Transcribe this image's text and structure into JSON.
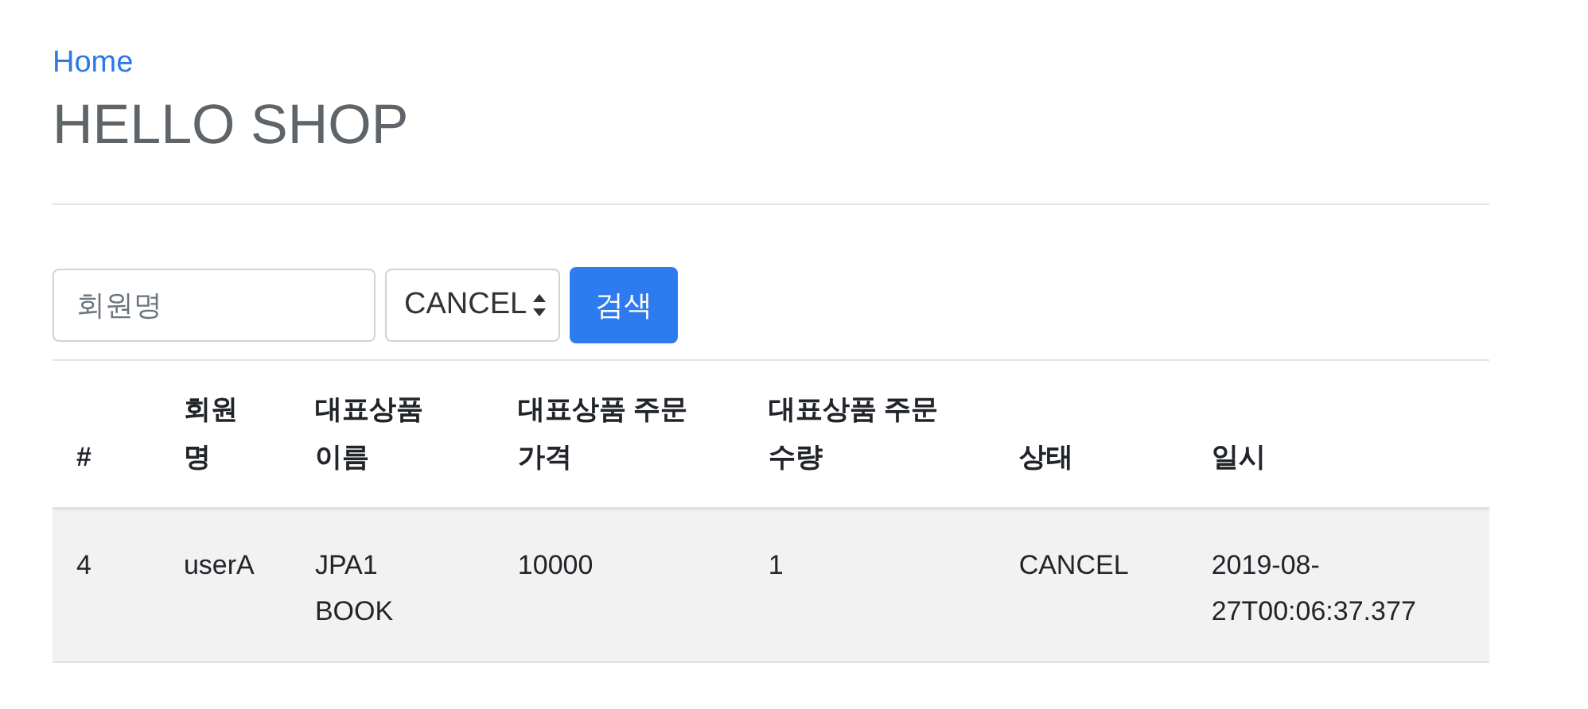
{
  "breadcrumb": "Home",
  "title": "HELLO SHOP",
  "search": {
    "placeholder": "회원명",
    "status": "CANCEL",
    "button": "검색"
  },
  "table": {
    "columns": [
      "#",
      "회원명",
      "대표상품 이름",
      "대표상품 주문 가격",
      "대표상품 주문 수량",
      "상태",
      "일시"
    ],
    "rows": [
      [
        "4",
        "userA",
        "JPA1 BOOK",
        "10000",
        "1",
        "CANCEL",
        "2019-08-27T00:06:37.377"
      ]
    ]
  }
}
